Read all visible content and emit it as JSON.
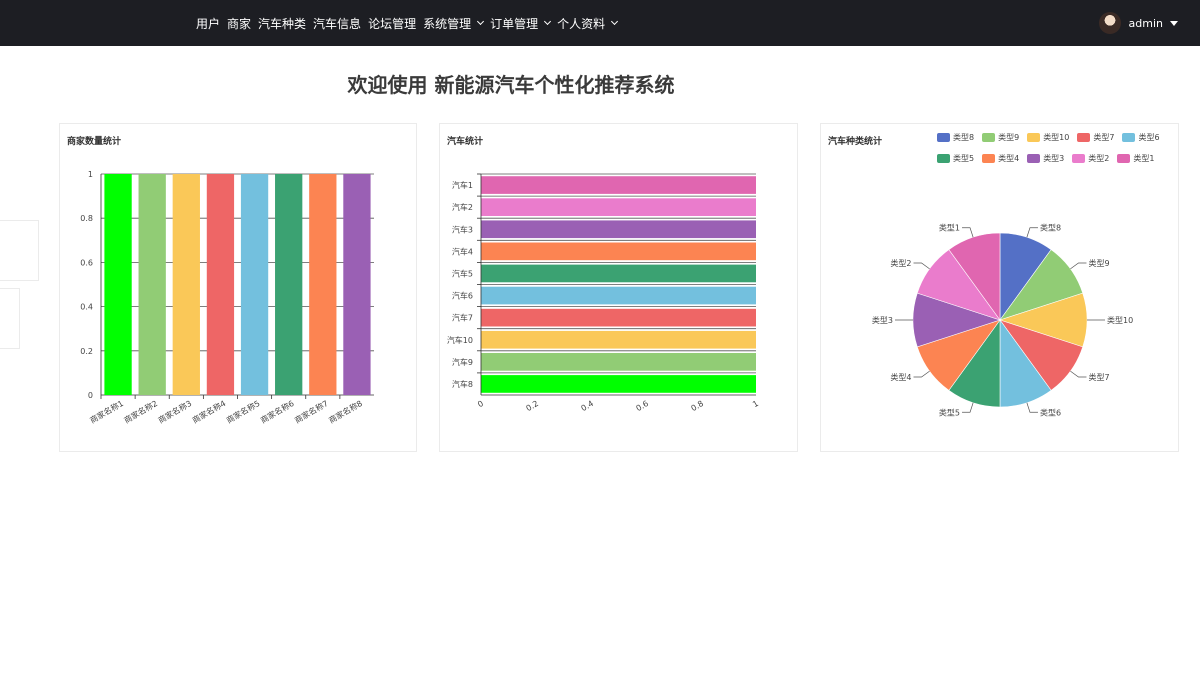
{
  "nav": {
    "items": [
      {
        "label": "用户",
        "has_dropdown": false
      },
      {
        "label": "商家",
        "has_dropdown": false
      },
      {
        "label": "汽车种类",
        "has_dropdown": false
      },
      {
        "label": "汽车信息",
        "has_dropdown": false
      },
      {
        "label": "论坛管理",
        "has_dropdown": false
      },
      {
        "label": "系统管理",
        "has_dropdown": true
      },
      {
        "label": "订单管理",
        "has_dropdown": true
      },
      {
        "label": "个人资料",
        "has_dropdown": true
      }
    ],
    "user": {
      "name": "admin"
    }
  },
  "page": {
    "title": "欢迎使用 新能源汽车个性化推荐系统"
  },
  "colors": {
    "topbar": "#1d1e23"
  },
  "cards": {
    "merchant": {
      "title": "商家数量统计"
    },
    "car": {
      "title": "汽车统计"
    },
    "category": {
      "title": "汽车种类统计"
    }
  },
  "chart_data": [
    {
      "type": "bar",
      "title": "商家数量统计",
      "categories": [
        "商家名称1",
        "商家名称2",
        "商家名称3",
        "商家名称4",
        "商家名称5",
        "商家名称6",
        "商家名称7",
        "商家名称8"
      ],
      "values": [
        1,
        1,
        1,
        1,
        1,
        1,
        1,
        1
      ],
      "colors": [
        "#00ff00",
        "#91cc75",
        "#fac858",
        "#ee6666",
        "#73c0de",
        "#3ba272",
        "#fc8452",
        "#9a60b4"
      ],
      "yticks": [
        "0",
        "0.2",
        "0.4",
        "0.6",
        "0.8",
        "1"
      ],
      "ylim": [
        0,
        1
      ],
      "grid": true
    },
    {
      "type": "bar",
      "orientation": "horizontal",
      "title": "汽车统计",
      "categories": [
        "汽车1",
        "汽车2",
        "汽车3",
        "汽车4",
        "汽车5",
        "汽车6",
        "汽车7",
        "汽车10",
        "汽车9",
        "汽车8"
      ],
      "values": [
        1,
        1,
        1,
        1,
        1,
        1,
        1,
        1,
        1,
        1
      ],
      "colors": [
        "#e066b0",
        "#ea7ccc",
        "#9a60b4",
        "#fc8452",
        "#3ba272",
        "#73c0de",
        "#ee6666",
        "#fac858",
        "#91cc75",
        "#00ff00"
      ],
      "xticks": [
        "0",
        "0.2",
        "0.4",
        "0.6",
        "0.8",
        "1"
      ],
      "xlim": [
        0,
        1
      ],
      "grid": true
    },
    {
      "type": "pie",
      "title": "汽车种类统计",
      "legend_position": "top-right",
      "legend": [
        {
          "name": "类型8",
          "color": "#5470c6"
        },
        {
          "name": "类型9",
          "color": "#91cc75"
        },
        {
          "name": "类型10",
          "color": "#fac858"
        },
        {
          "name": "类型7",
          "color": "#ee6666"
        },
        {
          "name": "类型6",
          "color": "#73c0de"
        },
        {
          "name": "类型5",
          "color": "#3ba272"
        },
        {
          "name": "类型4",
          "color": "#fc8452"
        },
        {
          "name": "类型3",
          "color": "#9a60b4"
        },
        {
          "name": "类型2",
          "color": "#ea7ccc"
        },
        {
          "name": "类型1",
          "color": "#e066b0"
        }
      ],
      "values": [
        1,
        1,
        1,
        1,
        1,
        1,
        1,
        1,
        1,
        1
      ]
    }
  ]
}
